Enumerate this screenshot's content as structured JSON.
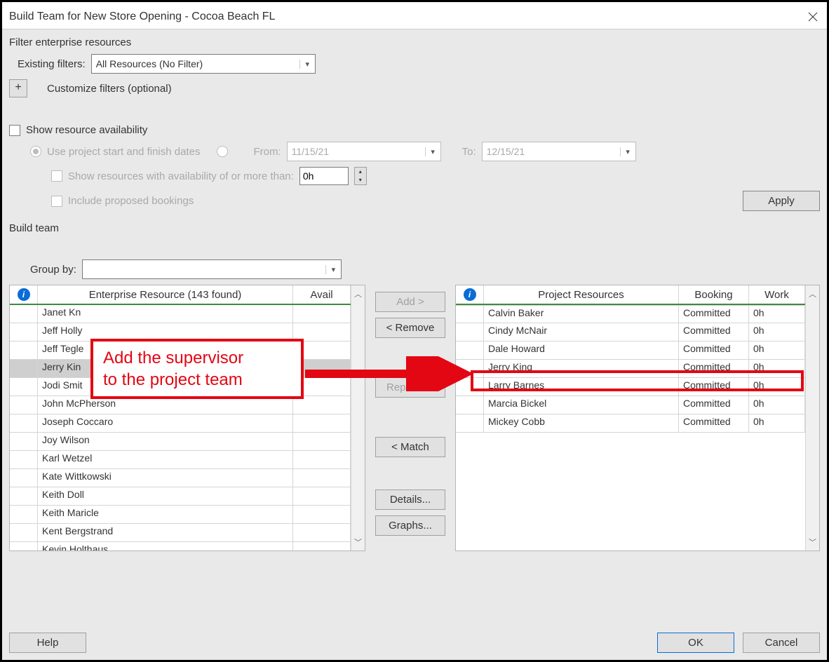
{
  "title": "Build Team for New Store Opening - Cocoa Beach FL",
  "filter_section": {
    "header": "Filter enterprise resources",
    "existing_label": "Existing filters:",
    "existing_value": "All Resources (No Filter)",
    "customize_label": "Customize filters (optional)",
    "show_avail_label": "Show resource availability",
    "use_dates_label": "Use project start and finish dates",
    "from_label": "From:",
    "from_value": "11/15/21",
    "to_label": "To:",
    "to_value": "12/15/21",
    "show_res_avail_label": "Show resources with availability of or more than:",
    "hours_value": "0h",
    "include_prop_label": "Include proposed bookings",
    "apply_label": "Apply"
  },
  "build_section": {
    "header": "Build team",
    "groupby_label": "Group by:"
  },
  "left_grid": {
    "header_resource": "Enterprise Resource (143 found)",
    "header_avail": "Avail",
    "rows": [
      "Janet Kn",
      "Jeff Holly",
      "Jeff Tegle",
      "Jerry Kin",
      "Jodi Smit",
      "John McPherson",
      "Joseph Coccaro",
      "Joy Wilson",
      "Karl Wetzel",
      "Kate Wittkowski",
      "Keith Doll",
      "Keith Maricle",
      "Kent Bergstrand",
      "Kevin Holthaus"
    ],
    "selected_index": 3
  },
  "right_grid": {
    "header_resource": "Project Resources",
    "header_booking": "Booking",
    "header_work": "Work",
    "rows": [
      {
        "name": "Calvin Baker",
        "booking": "Committed",
        "work": "0h"
      },
      {
        "name": "Cindy McNair",
        "booking": "Committed",
        "work": "0h"
      },
      {
        "name": "Dale Howard",
        "booking": "Committed",
        "work": "0h"
      },
      {
        "name": "Jerry King",
        "booking": "Committed",
        "work": "0h"
      },
      {
        "name": "Larry Barnes",
        "booking": "Committed",
        "work": "0h"
      },
      {
        "name": "Marcia Bickel",
        "booking": "Committed",
        "work": "0h"
      },
      {
        "name": "Mickey Cobb",
        "booking": "Committed",
        "work": "0h"
      }
    ]
  },
  "mid_buttons": {
    "add": "Add >",
    "remove": "< Remove",
    "replace": "Replace >",
    "match": "< Match",
    "details": "Details...",
    "graphs": "Graphs..."
  },
  "footer": {
    "help": "Help",
    "ok": "OK",
    "cancel": "Cancel"
  },
  "annotation": {
    "line1": "Add the supervisor",
    "line2": "to the project team"
  }
}
